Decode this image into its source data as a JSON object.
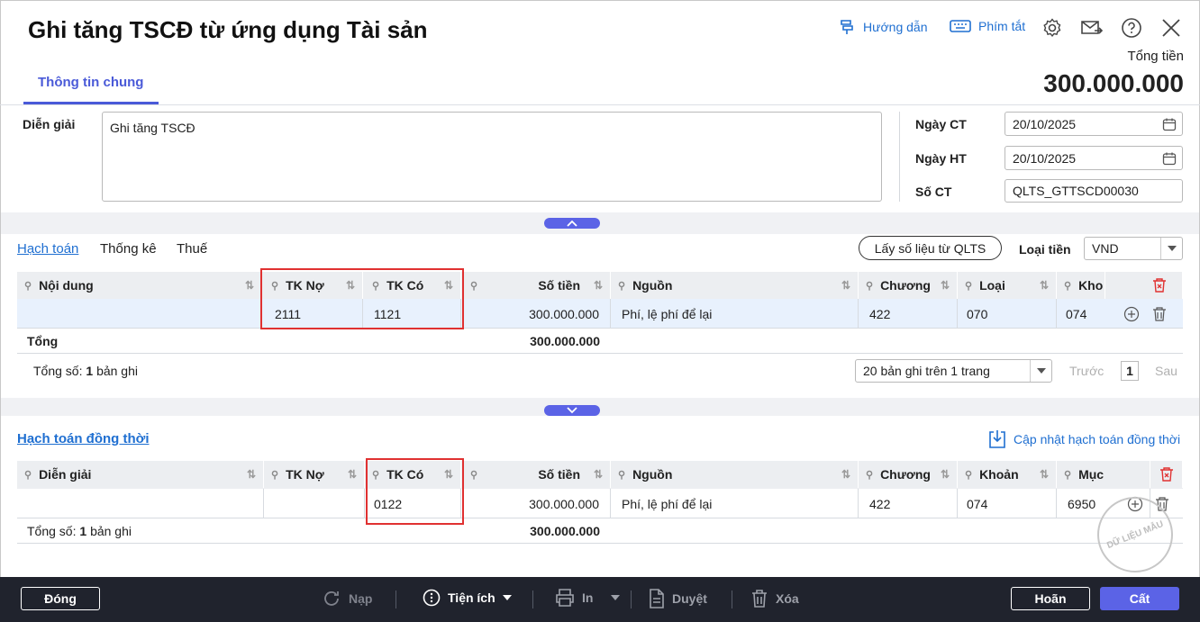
{
  "header": {
    "title": "Ghi tăng TSCĐ từ ứng dụng Tài sản",
    "guide_label": "Hướng dẫn",
    "shortcut_label": "Phím tắt",
    "total_label": "Tổng tiền",
    "total_value": "300.000.000"
  },
  "tabs": [
    {
      "label": "Thông tin chung"
    }
  ],
  "general": {
    "desc_label": "Diễn giải",
    "desc_value": "Ghi tăng TSCĐ",
    "date_ct_label": "Ngày CT",
    "date_ct_value": "20/10/2025",
    "date_ht_label": "Ngày HT",
    "date_ht_value": "20/10/2025",
    "so_ct_label": "Số CT",
    "so_ct_value": "QLTS_GTTSCD00030"
  },
  "detail": {
    "tabs": [
      "Hạch toán",
      "Thống kê",
      "Thuế"
    ],
    "fetch_button": "Lấy số liệu từ QLTS",
    "currency_label": "Loại tiền",
    "currency_value": "VND",
    "columns": [
      "Nội dung",
      "TK Nợ",
      "TK Có",
      "Số tiền",
      "Nguồn",
      "Chương",
      "Loại",
      "Kho"
    ],
    "rows": [
      {
        "noi_dung": "",
        "tk_no": "2111",
        "tk_co": "1121",
        "so_tien": "300.000.000",
        "nguon": "Phí, lệ phí để lại",
        "chuong": "422",
        "loai": "070",
        "kho": "074"
      }
    ],
    "total_label": "Tổng",
    "total_value": "300.000.000",
    "count_prefix": "Tổng số:",
    "count_value": "1",
    "count_suffix": "bản ghi",
    "page_size": "20 bản ghi trên 1 trang",
    "prev": "Trước",
    "page": "1",
    "next": "Sau"
  },
  "simul": {
    "title": "Hạch toán đồng thời",
    "update_label": "Cập nhật hạch toán đồng thời",
    "columns": [
      "Diễn giải",
      "TK Nợ",
      "TK Có",
      "Số tiền",
      "Nguồn",
      "Chương",
      "Khoản",
      "Mục"
    ],
    "rows": [
      {
        "dien_giai": "",
        "tk_no": "",
        "tk_co": "0122",
        "so_tien": "300.000.000",
        "nguon": "Phí, lệ phí để lại",
        "chuong": "422",
        "khoan": "074",
        "muc": "6950"
      }
    ],
    "count_prefix": "Tổng số:",
    "count_value": "1",
    "count_suffix": "bản ghi",
    "total_value": "300.000.000"
  },
  "watermark": "DỮ LIỆU MẪU",
  "footer": {
    "close": "Đóng",
    "reload": "Nạp",
    "utilities": "Tiện ích",
    "print": "In",
    "approve": "Duyệt",
    "delete": "Xóa",
    "cancel": "Hoãn",
    "save": "Cất"
  },
  "colors": {
    "accent": "#4a5ad8",
    "link": "#1f6fd1",
    "highlight": "#e03131",
    "footer": "#20232d"
  }
}
